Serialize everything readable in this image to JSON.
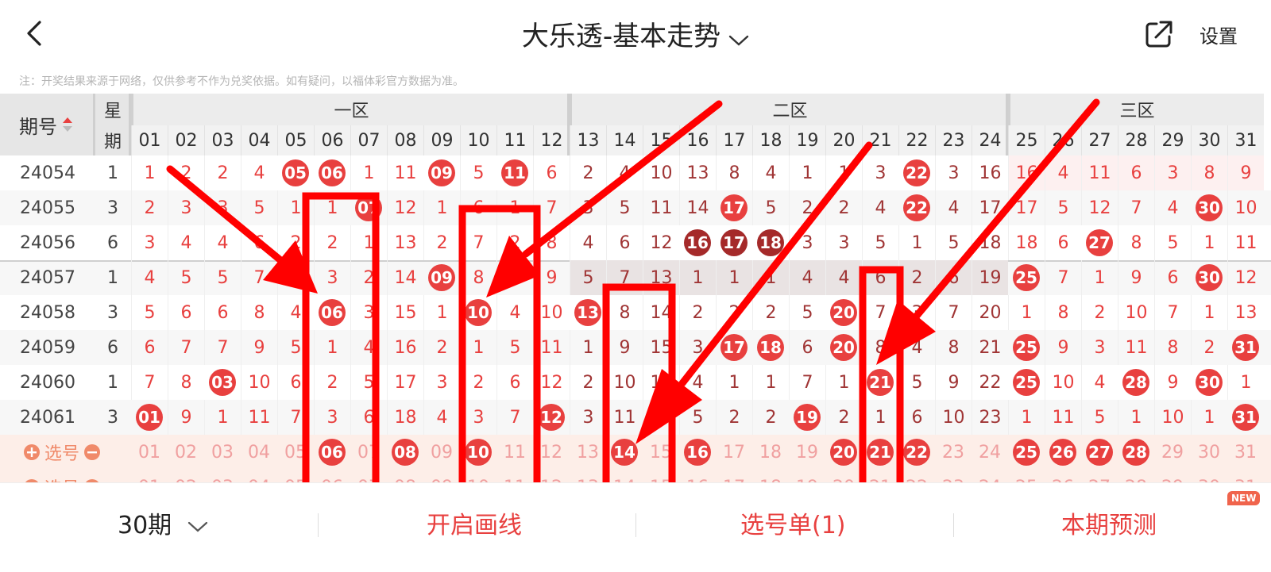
{
  "header": {
    "title": "大乐透-基本走势",
    "settings_label": "设置",
    "icons": {
      "back": "back-chevron-icon",
      "title_dropdown": "chevron-down-icon",
      "share": "share-icon"
    }
  },
  "note": "注：开奖结果来源于网络，仅供参考不作为兑奖依据。如有疑问，以福体彩官方数据为准。",
  "colors": {
    "red": "#e8403f",
    "dark_red": "#a52a2a",
    "pink_text": "#f0a0a0",
    "zone_header_bg": "#ececec",
    "annotation_red": "#ff0000"
  },
  "table": {
    "issue_header": "期号",
    "week_header": [
      "星",
      "期"
    ],
    "zones": [
      "一区",
      "二区",
      "三区"
    ],
    "numbers": [
      "01",
      "02",
      "03",
      "04",
      "05",
      "06",
      "07",
      "08",
      "09",
      "10",
      "11",
      "12",
      "13",
      "14",
      "15",
      "16",
      "17",
      "18",
      "19",
      "20",
      "21",
      "22",
      "23",
      "24",
      "25",
      "26",
      "27",
      "28",
      "29",
      "30",
      "31"
    ],
    "rows": [
      {
        "issue": "24054",
        "week": "1",
        "cells": [
          "1",
          "2",
          "2",
          "4",
          "05",
          "06",
          "1",
          "11",
          "09",
          "5",
          "11",
          "6",
          "2",
          "4",
          "10",
          "13",
          "8",
          "4",
          "1",
          "1",
          "3",
          "22",
          "3",
          "16",
          "16",
          "4",
          "11",
          "6",
          "3",
          "8",
          "9"
        ],
        "balls": [
          4,
          5,
          8,
          10,
          21
        ]
      },
      {
        "issue": "24055",
        "week": "3",
        "cells": [
          "2",
          "3",
          "3",
          "5",
          "1",
          "1",
          "07",
          "12",
          "1",
          "6",
          "1",
          "7",
          "3",
          "5",
          "11",
          "14",
          "17",
          "5",
          "2",
          "2",
          "4",
          "22",
          "4",
          "17",
          "17",
          "5",
          "12",
          "7",
          "4",
          "30",
          "10"
        ],
        "balls": [
          6,
          16,
          21,
          29
        ]
      },
      {
        "issue": "24056",
        "week": "6",
        "cells": [
          "3",
          "4",
          "4",
          "6",
          "2",
          "2",
          "1",
          "13",
          "2",
          "7",
          "2",
          "8",
          "4",
          "6",
          "12",
          "16",
          "17",
          "18",
          "3",
          "3",
          "5",
          "1",
          "5",
          "18",
          "18",
          "6",
          "27",
          "8",
          "5",
          "1",
          "11"
        ],
        "balls": [
          15,
          16,
          17,
          26
        ],
        "dark_balls": [
          15,
          16,
          17
        ]
      },
      {
        "issue": "24057",
        "week": "1",
        "cells": [
          "4",
          "5",
          "5",
          "7",
          "3",
          "3",
          "2",
          "14",
          "09",
          "8",
          "3",
          "9",
          "5",
          "7",
          "13",
          "1",
          "1",
          "1",
          "4",
          "4",
          "6",
          "2",
          "6",
          "19",
          "25",
          "7",
          "1",
          "9",
          "6",
          "30",
          "12"
        ],
        "balls": [
          8,
          24,
          29
        ]
      },
      {
        "issue": "24058",
        "week": "3",
        "cells": [
          "5",
          "6",
          "6",
          "8",
          "4",
          "06",
          "3",
          "15",
          "1",
          "10",
          "4",
          "10",
          "13",
          "8",
          "14",
          "2",
          "2",
          "2",
          "5",
          "20",
          "7",
          "3",
          "7",
          "20",
          "1",
          "8",
          "2",
          "10",
          "7",
          "1",
          "13"
        ],
        "balls": [
          5,
          9,
          12,
          19
        ]
      },
      {
        "issue": "24059",
        "week": "6",
        "cells": [
          "6",
          "7",
          "7",
          "9",
          "5",
          "1",
          "4",
          "16",
          "2",
          "1",
          "5",
          "11",
          "1",
          "9",
          "15",
          "3",
          "17",
          "18",
          "6",
          "20",
          "8",
          "4",
          "8",
          "21",
          "25",
          "9",
          "3",
          "11",
          "8",
          "2",
          "31"
        ],
        "balls": [
          16,
          17,
          19,
          24,
          30
        ]
      },
      {
        "issue": "24060",
        "week": "1",
        "cells": [
          "7",
          "8",
          "03",
          "10",
          "6",
          "2",
          "5",
          "17",
          "3",
          "2",
          "6",
          "12",
          "2",
          "10",
          "16",
          "4",
          "1",
          "1",
          "7",
          "1",
          "21",
          "5",
          "9",
          "22",
          "25",
          "10",
          "4",
          "28",
          "9",
          "30",
          "1"
        ],
        "balls": [
          2,
          20,
          24,
          27,
          29
        ]
      },
      {
        "issue": "24061",
        "week": "3",
        "cells": [
          "01",
          "9",
          "1",
          "11",
          "7",
          "3",
          "6",
          "18",
          "4",
          "3",
          "7",
          "12",
          "3",
          "11",
          "17",
          "5",
          "2",
          "2",
          "19",
          "2",
          "1",
          "6",
          "10",
          "23",
          "1",
          "11",
          "5",
          "1",
          "10",
          "1",
          "31"
        ],
        "balls": [
          0,
          11,
          18,
          30
        ]
      }
    ],
    "select_rows": [
      {
        "label": "选号",
        "selected": [
          5,
          7,
          9,
          13,
          15,
          19,
          20,
          21,
          24,
          25,
          26,
          27
        ]
      },
      {
        "label": "选号",
        "selected": []
      }
    ]
  },
  "footer": {
    "period": "30期",
    "draw_line": "开启画线",
    "selection_list": "选号单(1)",
    "prediction": "本期预测",
    "new_badge": "NEW"
  }
}
